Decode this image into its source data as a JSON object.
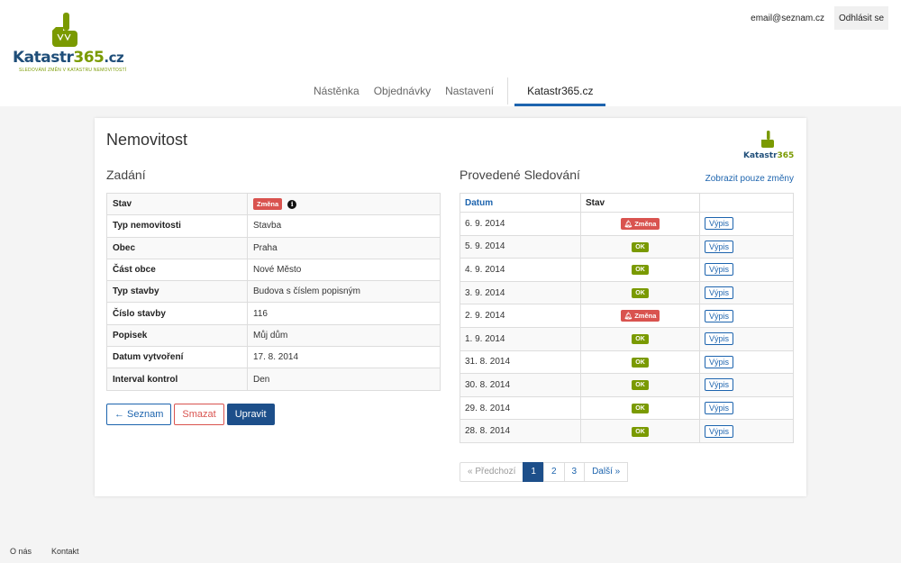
{
  "brand": {
    "name_part1": "Katastr",
    "name_part2": "365",
    "name_part3": ".cz",
    "tagline": "Sledování změn v katastru nemovitostí",
    "green": "#7a9a01",
    "blue": "#1f4e79"
  },
  "header": {
    "email": "email@seznam.cz",
    "logout_label": "Odhlásit se"
  },
  "nav": {
    "items": [
      {
        "label": "Nástěnka"
      },
      {
        "label": "Objednávky"
      },
      {
        "label": "Nastavení"
      }
    ],
    "active_label": "Katastr365.cz"
  },
  "page": {
    "title": "Nemovitost"
  },
  "assignment": {
    "title": "Zadání",
    "rows": [
      {
        "key": "Stav",
        "value": "Změna"
      },
      {
        "key": "Typ nemovitosti",
        "value": "Stavba"
      },
      {
        "key": "Obec",
        "value": "Praha"
      },
      {
        "key": "Část obce",
        "value": "Nové Město"
      },
      {
        "key": "Typ stavby",
        "value": "Budova s číslem popisným"
      },
      {
        "key": "Číslo stavby",
        "value": "116"
      },
      {
        "key": "Popisek",
        "value": "Můj dům"
      },
      {
        "key": "Datum vytvoření",
        "value": "17. 8. 2014"
      },
      {
        "key": "Interval kontrol",
        "value": "Den"
      }
    ],
    "buttons": {
      "back": "← Seznam",
      "delete": "Smazat",
      "edit": "Upravit"
    }
  },
  "monitoring": {
    "title": "Provedené Sledování",
    "filter_link": "Zobrazit pouze změny",
    "headers": {
      "date": "Datum",
      "state": "Stav",
      "action": ""
    },
    "rows": [
      {
        "date": "6. 9. 2014",
        "state": "Změna",
        "action": "Výpis"
      },
      {
        "date": "5. 9. 2014",
        "state": "OK",
        "action": "Výpis"
      },
      {
        "date": "4. 9. 2014",
        "state": "OK",
        "action": "Výpis"
      },
      {
        "date": "3. 9. 2014",
        "state": "OK",
        "action": "Výpis"
      },
      {
        "date": "2. 9. 2014",
        "state": "Změna",
        "action": "Výpis"
      },
      {
        "date": "1. 9. 2014",
        "state": "OK",
        "action": "Výpis"
      },
      {
        "date": "31. 8. 2014",
        "state": "OK",
        "action": "Výpis"
      },
      {
        "date": "30. 8. 2014",
        "state": "OK",
        "action": "Výpis"
      },
      {
        "date": "29. 8. 2014",
        "state": "OK",
        "action": "Výpis"
      },
      {
        "date": "28. 8. 2014",
        "state": "OK",
        "action": "Výpis"
      }
    ],
    "pagination": {
      "prev": "« Předchozí",
      "pages": [
        "1",
        "2",
        "3"
      ],
      "current": "1",
      "next": "Další »"
    }
  },
  "footer": {
    "links": [
      {
        "label": "O nás"
      },
      {
        "label": "Kontakt"
      }
    ]
  }
}
